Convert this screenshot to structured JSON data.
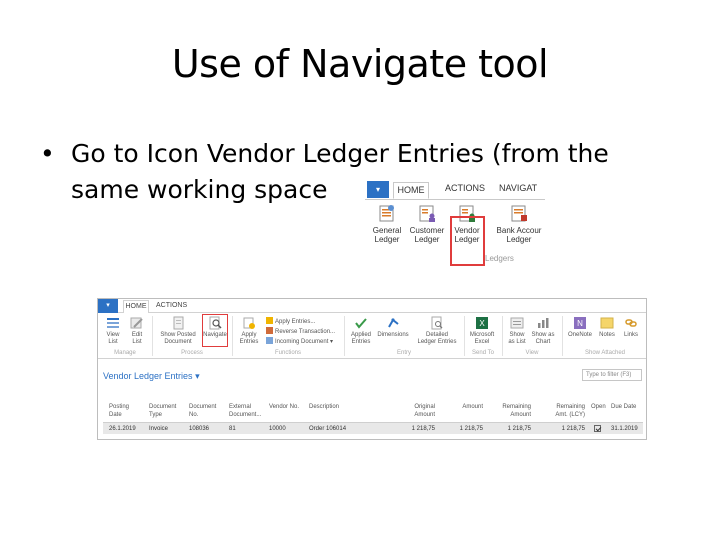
{
  "slide": {
    "title": "Use of Navigate tool",
    "bullet_symbol": "•",
    "bullet_text": "Go to Icon Vendor Ledger Entries (from the same working space"
  },
  "mini_ribbon": {
    "tabs": [
      "HOME",
      "ACTIONS",
      "NAVIGAT"
    ],
    "buttons": [
      {
        "line1": "General",
        "line2": "Ledger",
        "icon": "general-ledger-icon"
      },
      {
        "line1": "Customer",
        "line2": "Ledger",
        "icon": "customer-ledger-icon"
      },
      {
        "line1": "Vendor",
        "line2": "Ledger",
        "icon": "vendor-ledger-icon"
      },
      {
        "line1": "Bank Accour",
        "line2": "Ledger",
        "icon": "bank-account-ledger-icon"
      }
    ],
    "group_label": "Ledgers"
  },
  "ribbon": {
    "tabs": [
      "HOME",
      "ACTIONS"
    ],
    "buttons": {
      "view": {
        "line1": "View",
        "line2": "List"
      },
      "edit": {
        "line1": "Edit",
        "line2": "List"
      },
      "show_posted": {
        "line1": "Show Posted",
        "line2": "Document"
      },
      "navigate": {
        "line1": "Navigate",
        "line2": ""
      },
      "apply": {
        "line1": "Apply",
        "line2": "Entries"
      },
      "applied": {
        "line1": "Applied",
        "line2": "Entries"
      },
      "dimensions": {
        "line1": "Dimensions",
        "line2": ""
      },
      "detailed": {
        "line1": "Detailed",
        "line2": "Ledger Entries"
      },
      "excel": {
        "line1": "Microsoft",
        "line2": "Excel"
      },
      "show_as_list": {
        "line1": "Show",
        "line2": "as List"
      },
      "show_as_chart": {
        "line1": "Show as",
        "line2": "Chart"
      },
      "onenote": {
        "line1": "OneNote",
        "line2": ""
      },
      "notes": {
        "line1": "Notes",
        "line2": ""
      },
      "links": {
        "line1": "Links",
        "line2": ""
      }
    },
    "small_items": [
      "Apply Entries...",
      "Reverse Transaction...",
      "Incoming Document"
    ],
    "groups": [
      "Manage",
      "Process",
      "Functions",
      "Entry",
      "Send To",
      "View",
      "Show Attached"
    ]
  },
  "page": {
    "title": "Vendor Ledger Entries",
    "title_caret": "▾",
    "filter_placeholder": "Type to filter (F3)"
  },
  "table": {
    "headers": [
      [
        "Posting",
        "Date"
      ],
      [
        "Document",
        "Type"
      ],
      [
        "Document",
        "No."
      ],
      [
        "External",
        "Document..."
      ],
      [
        "Vendor No.",
        ""
      ],
      [
        "Description",
        ""
      ],
      [
        "Original",
        "Amount"
      ],
      [
        "Amount",
        ""
      ],
      [
        "Remaining",
        "Amount"
      ],
      [
        "Remaining",
        "Amt. (LCY)"
      ],
      [
        "Open",
        ""
      ],
      [
        "Due Date",
        ""
      ]
    ],
    "rows": [
      [
        "26.1.2019",
        "Invoice",
        "108036",
        "81",
        "10000",
        "Order 106014",
        "1 218,75",
        "1 218,75",
        "1 218,75",
        "1 218,75",
        true,
        "31.1.2019"
      ]
    ]
  },
  "colors": {
    "accent": "#2c71c4",
    "highlight": "#e03c3c",
    "row_selected": "#e8e8e8"
  }
}
